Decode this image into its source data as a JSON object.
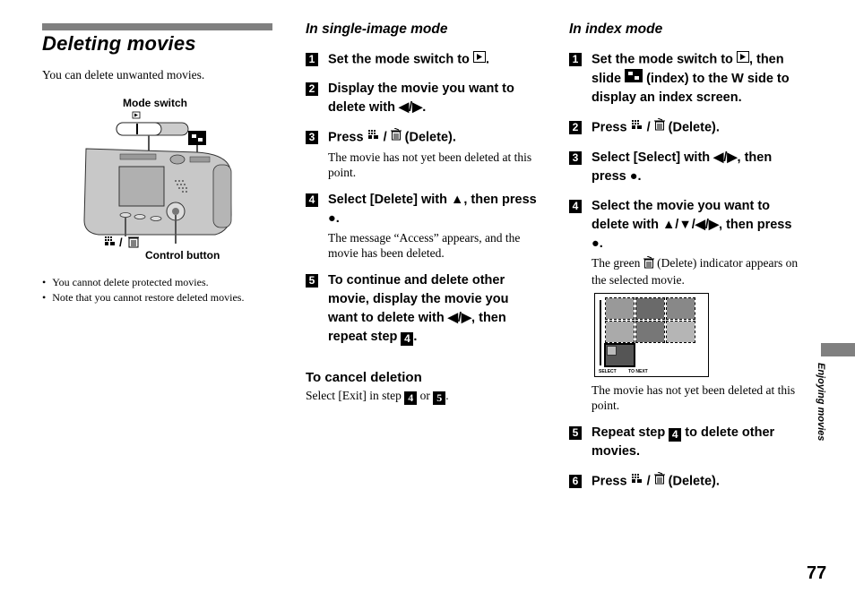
{
  "page": {
    "title": "Deleting movies",
    "intro": "You can delete unwanted movies.",
    "page_number": "77",
    "side_tab": "Enjoying movies"
  },
  "diagram": {
    "mode_switch_label": "Mode switch",
    "control_button_label": "Control button",
    "delete_button_label": "/"
  },
  "notes": [
    "You cannot delete protected movies.",
    "Note that you cannot restore deleted movies."
  ],
  "single": {
    "heading": "In single-image mode",
    "steps": [
      {
        "num": "1",
        "title_a": "Set the mode switch to ",
        "title_b": "."
      },
      {
        "num": "2",
        "title": "Display the movie you want to delete with ◀/▶."
      },
      {
        "num": "3",
        "title_a": "Press ",
        "title_b": " / ",
        "title_c": " (Delete).",
        "note": "The movie has not yet been deleted at this point."
      },
      {
        "num": "4",
        "title": "Select [Delete] with ▲, then press ●.",
        "note": "The message “Access” appears, and the movie has been deleted."
      },
      {
        "num": "5",
        "title_a": "To continue and delete other movie, display the movie you want to delete with ◀/▶, then repeat step ",
        "ref": "4",
        "title_b": "."
      }
    ],
    "cancel_heading": "To cancel deletion",
    "cancel_text_a": "Select [Exit] in step ",
    "cancel_ref1": "4",
    "cancel_mid": " or ",
    "cancel_ref2": "5",
    "cancel_end": "."
  },
  "index": {
    "heading": "In index mode",
    "steps": [
      {
        "num": "1",
        "title_a": "Set the mode switch to ",
        "title_b": ", then slide ",
        "title_c": " (index) to the W side to display an index screen."
      },
      {
        "num": "2",
        "title_a": "Press ",
        "title_b": " / ",
        "title_c": " (Delete)."
      },
      {
        "num": "3",
        "title": "Select [Select] with ◀/▶, then press ●."
      },
      {
        "num": "4",
        "title": "Select the movie you want to delete with ▲/▼/◀/▶, then press ●.",
        "note_a": "The green ",
        "note_b": " (Delete) indicator appears on the selected movie.",
        "note2": "The movie has not yet been deleted at this point."
      },
      {
        "num": "5",
        "title_a": "Repeat step ",
        "ref": "4",
        "title_b": " to delete other movies."
      },
      {
        "num": "6",
        "title_a": "Press ",
        "title_b": " / ",
        "title_c": " (Delete)."
      }
    ],
    "screen": {
      "footer_select": "SELECT",
      "footer_next": "TO NEXT"
    }
  }
}
